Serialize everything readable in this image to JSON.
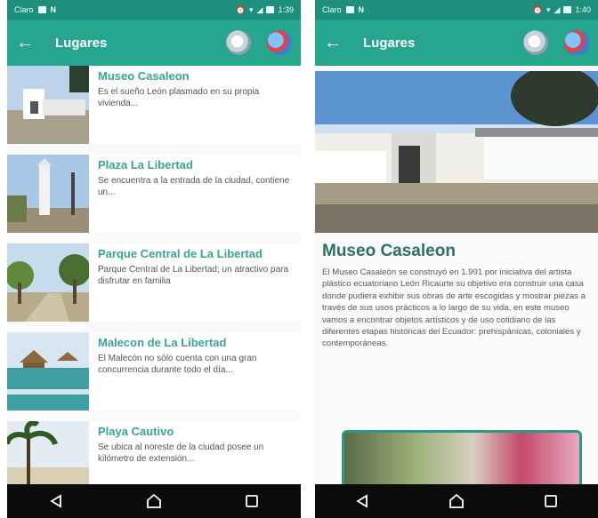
{
  "left_screen": {
    "status_bar": {
      "carrier": "Claro",
      "time": "1:39"
    },
    "app_bar": {
      "back_icon": "arrow-left-icon",
      "title": "Lugares",
      "search_icon": "search-icon",
      "globe_icon": "globe-icon"
    },
    "places": [
      {
        "title": "Museo Casaleon",
        "description": "Es el sueño León plasmado en su propia vivienda..."
      },
      {
        "title": "Plaza La Libertad",
        "description": "Se encuentra a la entrada de la ciudad, contiene un..."
      },
      {
        "title": "Parque Central de La Libertad",
        "description": "Parque Central de La Libertad; un atractivo para disfrutar en familia"
      },
      {
        "title": "Malecon de La Libertad",
        "description": "El Malecón no sólo cuenta con una gran concurrencia durante todo el día..."
      },
      {
        "title": "Playa Cautivo",
        "description": "Se ubica al noreste de la ciudad posee un kilómetro de extensión..."
      }
    ],
    "nav_bar": {
      "back": "nav-back-icon",
      "home": "nav-home-icon",
      "recents": "nav-recents-icon"
    }
  },
  "right_screen": {
    "status_bar": {
      "carrier": "Claro",
      "time": "1:40"
    },
    "app_bar": {
      "back_icon": "arrow-left-icon",
      "title": "Lugares",
      "search_icon": "search-icon",
      "globe_icon": "globe-icon"
    },
    "detail": {
      "title": "Museo Casaleon",
      "body": "El Museo Casaleón se construyó en 1.991 por iniciativa del artista plástico ecuatoriano León Ricaurte su objetivo era construir una casa donde pudiera exhibir sus obras de arte escogidas y mostrar piezas a través de sus usos prácticos a lo largo de su vida, en este museo vamos a encontrar objetos artísticos y de uso cotidiano de las diferentes etapas históricas del Ecuador: prehispánicas, coloniales y contemporáneas."
    },
    "nav_bar": {
      "back": "nav-back-icon",
      "home": "nav-home-icon",
      "recents": "nav-recents-icon"
    }
  },
  "colors": {
    "status": "#1d8f7c",
    "app_bar": "#26a58f",
    "title_text": "#38a493",
    "detail_title": "#2e6f66",
    "nav": "#0b0b0b"
  }
}
